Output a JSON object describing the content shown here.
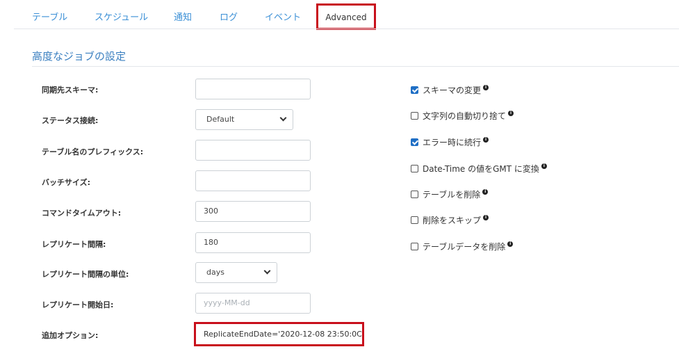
{
  "tabs": [
    {
      "label": "テーブル"
    },
    {
      "label": "スケジュール"
    },
    {
      "label": "通知"
    },
    {
      "label": "ログ"
    },
    {
      "label": "イベント"
    },
    {
      "label": "Advanced"
    }
  ],
  "section_title": "高度なジョブの設定",
  "fields": {
    "sync_schema": {
      "label": "同期先スキーマ:",
      "value": ""
    },
    "status_connection": {
      "label": "ステータス接続:",
      "value": "Default"
    },
    "table_prefix": {
      "label": "テーブル名のプレフィックス:",
      "value": ""
    },
    "batch_size": {
      "label": "バッチサイズ:",
      "value": ""
    },
    "command_timeout": {
      "label": "コマンドタイムアウト:",
      "value": "300"
    },
    "replicate_interval": {
      "label": "レプリケート間隔:",
      "value": "180"
    },
    "replicate_interval_unit": {
      "label": "レプリケート間隔の単位:",
      "value": "days"
    },
    "replicate_start_date": {
      "label": "レプリケート開始日:",
      "value": "",
      "placeholder": "yyyy-MM-dd"
    },
    "additional_options": {
      "label": "追加オプション:",
      "value": "ReplicateEndDate='2020-12-08 23:50:0C"
    }
  },
  "checkboxes": [
    {
      "label": "スキーマの変更",
      "checked": true
    },
    {
      "label": "文字列の自動切り捨て",
      "checked": false
    },
    {
      "label": "エラー時に続行",
      "checked": true
    },
    {
      "label": "Date-Time の値をGMT に変換",
      "checked": false
    },
    {
      "label": "テーブルを削除",
      "checked": false
    },
    {
      "label": "削除をスキップ",
      "checked": false
    },
    {
      "label": "テーブルデータを削除",
      "checked": false
    }
  ],
  "info_icon_glyph": "i",
  "colors": {
    "accent": "#3a8fd6",
    "highlight": "#c8101c",
    "checkbox": "#1f6fc5"
  }
}
